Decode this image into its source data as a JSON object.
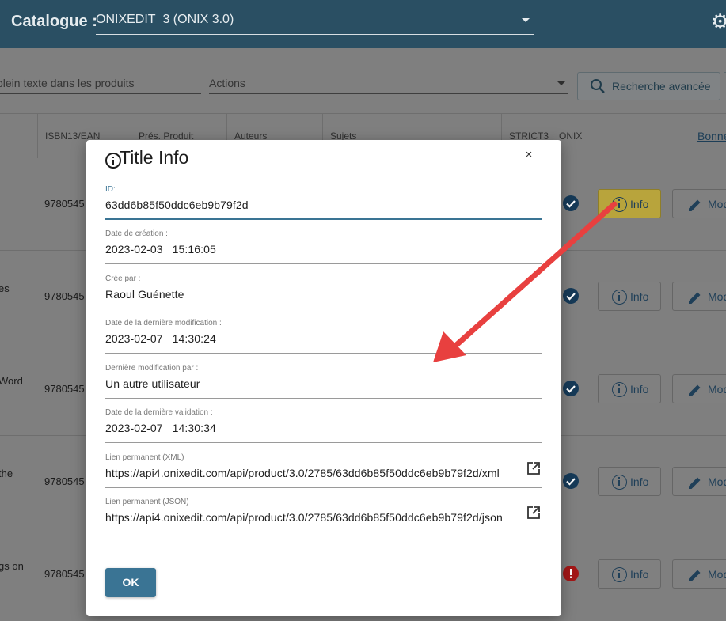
{
  "header": {
    "catalogue_label": "Catalogue :",
    "catalogue_value": "ONIXEDIT_3 (ONIX 3.0)",
    "settings_icon": "gear-icon"
  },
  "toolbar": {
    "search_placeholder": "plein texte dans les produits",
    "actions_label": "Actions",
    "advanced_search_label": "Recherche avancée"
  },
  "table": {
    "columns": [
      "ISBN13/EAN",
      "Prés. Produit",
      "Auteurs",
      "Sujets",
      "STRICT3",
      "ONIX"
    ],
    "right_link": "Bonne",
    "rows": [
      {
        "title": "",
        "isbn": "9780545",
        "status": "valid",
        "info_label": "Info",
        "modify_label": "Mod"
      },
      {
        "title": "es",
        "isbn": "9780545",
        "status": "valid",
        "info_label": "Info",
        "modify_label": "Mod"
      },
      {
        "title": "Word",
        "isbn": "9780545",
        "status": "valid",
        "info_label": "Info",
        "modify_label": "Mod"
      },
      {
        "title": "the",
        "isbn": "9780545",
        "status": "valid",
        "info_label": "Info",
        "modify_label": "Mod"
      },
      {
        "title": "gs on",
        "isbn": "9780545",
        "status": "error",
        "info_label": "Info",
        "modify_label": "Mod"
      }
    ]
  },
  "modal": {
    "title": "Title Info",
    "close_symbol": "×",
    "fields": [
      {
        "label": "ID:",
        "value": "63dd6b85f50ddc6eb9b79f2d"
      },
      {
        "label": "Date de création :",
        "value": "2023-02-03   15:16:05"
      },
      {
        "label": "Crée par :",
        "value": "Raoul Guénette"
      },
      {
        "label": "Date de la dernière modification :",
        "value": "2023-02-07   14:30:24"
      },
      {
        "label": "Dernière modification par :",
        "value": "Un autre utilisateur"
      },
      {
        "label": "Date de la dernière validation :",
        "value": "2023-02-07   14:30:34"
      },
      {
        "label": "Lien permanent (XML)",
        "value": "https://api4.onixedit.com/api/product/3.0/2785/63dd6b85f50ddc6eb9b79f2d/xml"
      },
      {
        "label": "Lien permanent (JSON)",
        "value": "https://api4.onixedit.com/api/product/3.0/2785/63dd6b85f50ddc6eb9b79f2d/json"
      }
    ],
    "ok_label": "OK"
  },
  "colors": {
    "header_bg": "#2a4f63",
    "accent": "#3a7494",
    "highlight_button": "#b8a43c",
    "arrow": "#e8403f"
  }
}
